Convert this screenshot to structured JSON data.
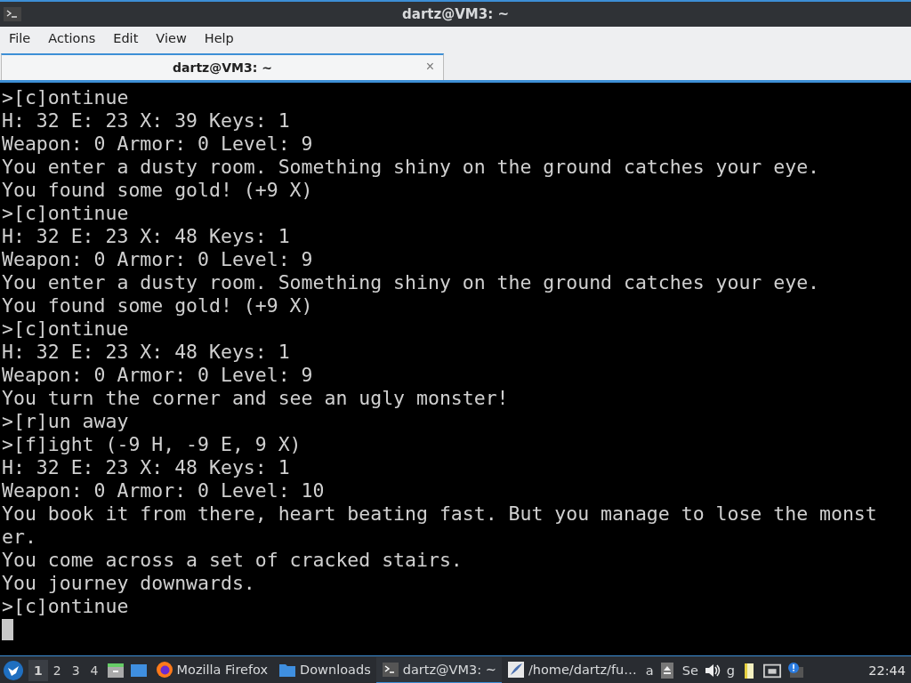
{
  "window": {
    "title": "dartz@VM3: ~"
  },
  "menu": [
    "File",
    "Actions",
    "Edit",
    "View",
    "Help"
  ],
  "tabs": [
    {
      "label": "dartz@VM3: ~",
      "selected": true,
      "close": "×"
    }
  ],
  "terminal": {
    "lines": [
      ">[c]ontinue",
      "H: 32 E: 23 X: 39 Keys: 1",
      "Weapon: 0 Armor: 0 Level: 9",
      "You enter a dusty room. Something shiny on the ground catches your eye.",
      "You found some gold! (+9 X)",
      ">[c]ontinue",
      "H: 32 E: 23 X: 48 Keys: 1",
      "Weapon: 0 Armor: 0 Level: 9",
      "You enter a dusty room. Something shiny on the ground catches your eye.",
      "You found some gold! (+9 X)",
      ">[c]ontinue",
      "H: 32 E: 23 X: 48 Keys: 1",
      "Weapon: 0 Armor: 0 Level: 9",
      "You turn the corner and see an ugly monster!",
      ">[r]un away",
      ">[f]ight (-9 H, -9 E, 9 X)",
      "H: 32 E: 23 X: 48 Keys: 1",
      "Weapon: 0 Armor: 0 Level: 10",
      "You book it from there, heart beating fast. But you manage to lose the monst",
      "er.",
      "You come across a set of cracked stairs.",
      "You journey downwards.",
      ">[c]ontinue"
    ]
  },
  "taskbar": {
    "workspaces": [
      {
        "label": "1",
        "selected": true
      },
      {
        "label": "2",
        "selected": false
      },
      {
        "label": "3",
        "selected": false
      },
      {
        "label": "4",
        "selected": false
      }
    ],
    "tasks": [
      {
        "kind": "firefox",
        "label": "Mozilla Firefox",
        "selected": false
      },
      {
        "kind": "folder",
        "label": "Downloads",
        "selected": false
      },
      {
        "kind": "terminal",
        "label": "dartz@VM3: ~",
        "selected": true
      },
      {
        "kind": "editor",
        "label": "/home/dartz/fu…",
        "selected": false
      }
    ],
    "tray_texts": [
      "a",
      "Se",
      "g"
    ],
    "clock": "22:44"
  }
}
